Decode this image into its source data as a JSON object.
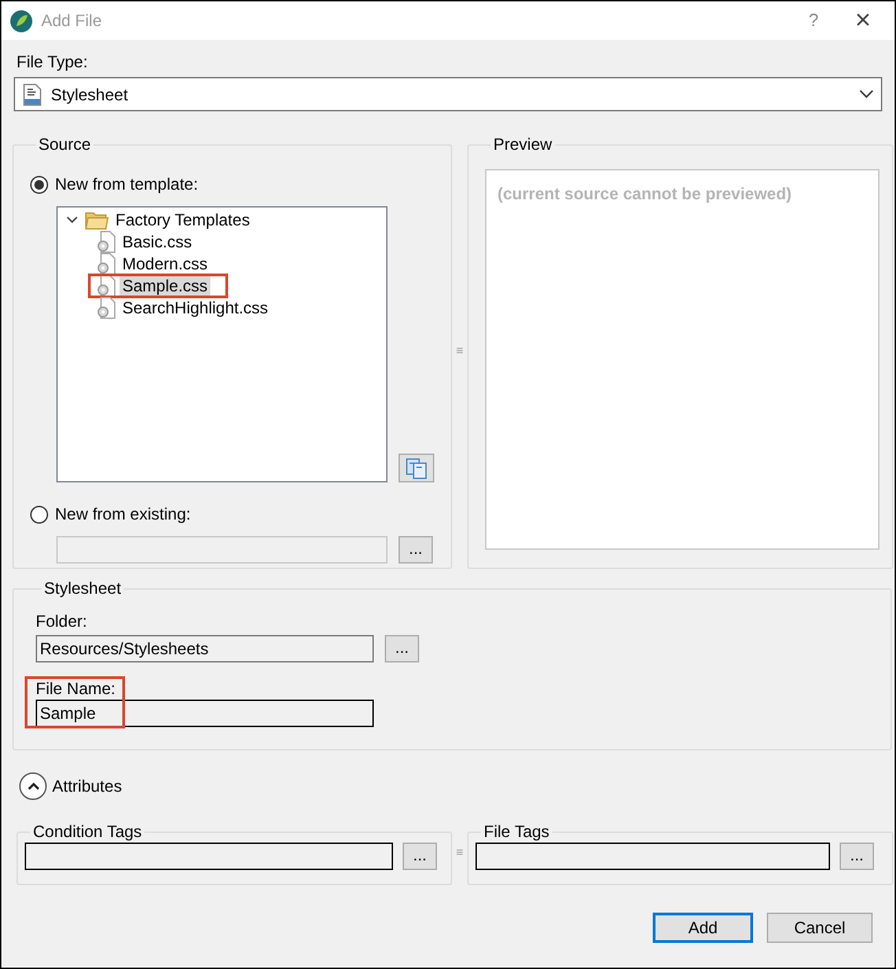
{
  "window": {
    "title": "Add File",
    "help_button": "?",
    "close_button": "×"
  },
  "file_type": {
    "label": "File Type:",
    "value": "Stylesheet"
  },
  "source": {
    "title": "Source",
    "options": [
      {
        "label": "New from template:",
        "selected": true
      },
      {
        "label": "New from existing:",
        "selected": false
      }
    ],
    "tree": [
      {
        "label": "Factory Templates",
        "kind": "folder",
        "expanded": true,
        "selected": false,
        "highlighted": false,
        "children": [
          {
            "label": "Basic.css",
            "kind": "file",
            "selected": false,
            "highlighted": false
          },
          {
            "label": "Modern.css",
            "kind": "file",
            "selected": false,
            "highlighted": false
          },
          {
            "label": "Sample.css",
            "kind": "file",
            "selected": true,
            "highlighted": true
          },
          {
            "label": "SearchHighlight.css",
            "kind": "file",
            "selected": false,
            "highlighted": false
          }
        ]
      }
    ],
    "browse_button": "..."
  },
  "splitters": [
    "≡",
    "≡"
  ],
  "preview": {
    "title": "Preview",
    "message": "(current source cannot be previewed)"
  },
  "stylesheet": {
    "title": "Stylesheet",
    "folder_label": "Folder:",
    "folder_value": "Resources/Stylesheets",
    "folder_button": "...",
    "file_name_label": "File Name:",
    "file_name_value": "Sample",
    "file_name_highlighted": true
  },
  "attributes": {
    "label": "Attributes",
    "expanded": true
  },
  "condition_tags": {
    "title": "Condition Tags",
    "button": "..."
  },
  "file_tags": {
    "title": "File Tags",
    "button": "..."
  },
  "buttons": [
    {
      "label": "Add",
      "default": true
    },
    {
      "label": "Cancel",
      "default": false
    }
  ]
}
